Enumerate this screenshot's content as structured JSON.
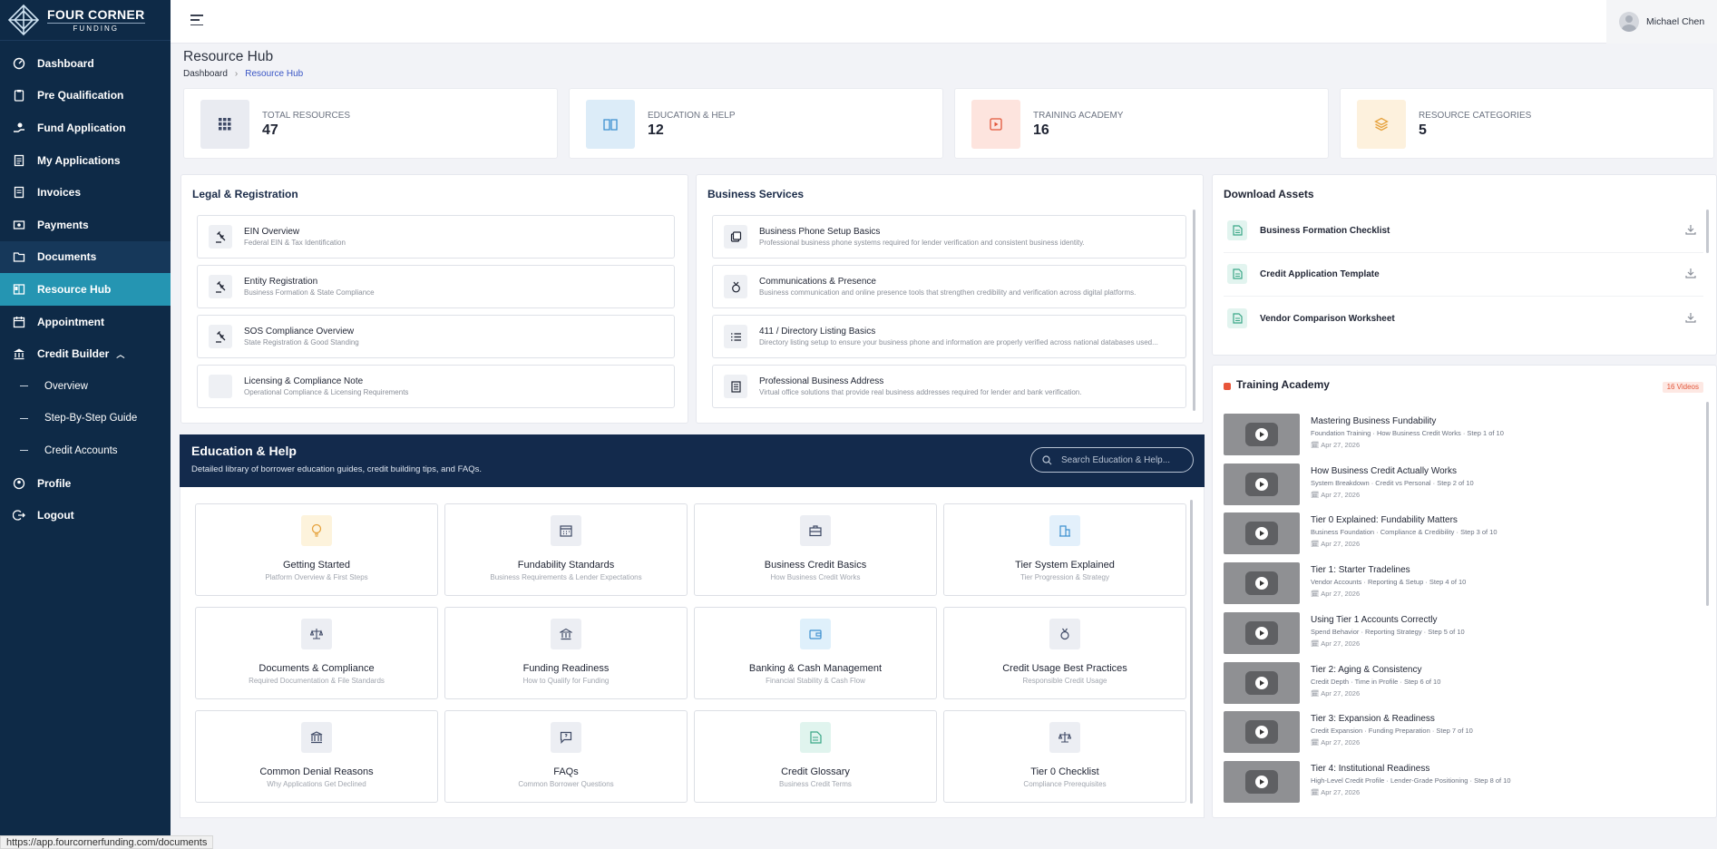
{
  "brand": {
    "title": "FOUR CORNER",
    "subtitle": "FUNDING"
  },
  "sidebar": {
    "items": [
      {
        "label": "Dashboard",
        "icon": "dashboard-icon"
      },
      {
        "label": "Pre Qualification",
        "icon": "clipboard-icon"
      },
      {
        "label": "Fund Application",
        "icon": "hand-coin-icon"
      },
      {
        "label": "My Applications",
        "icon": "file-list-icon"
      },
      {
        "label": "Invoices",
        "icon": "invoice-icon"
      },
      {
        "label": "Payments",
        "icon": "money-icon"
      },
      {
        "label": "Documents",
        "icon": "folder-icon"
      },
      {
        "label": "Resource Hub",
        "icon": "book-icon"
      },
      {
        "label": "Appointment",
        "icon": "calendar-icon"
      },
      {
        "label": "Credit Builder",
        "icon": "bank-icon"
      },
      {
        "label": "Overview"
      },
      {
        "label": "Step-By-Step Guide"
      },
      {
        "label": "Credit Accounts"
      },
      {
        "label": "Profile",
        "icon": "user-icon"
      },
      {
        "label": "Logout",
        "icon": "logout-icon"
      }
    ]
  },
  "topbar": {
    "user_name": "Michael Chen"
  },
  "page": {
    "title": "Resource Hub",
    "breadcrumb": [
      "Dashboard",
      "Resource Hub"
    ]
  },
  "stats": [
    {
      "label": "TOTAL RESOURCES",
      "value": "47",
      "color": "#e9ebf1",
      "icon": "grid-icon"
    },
    {
      "label": "EDUCATION & HELP",
      "value": "12",
      "color": "#dcecf8",
      "icon": "book-open-icon"
    },
    {
      "label": "TRAINING ACADEMY",
      "value": "16",
      "color": "#fde4de",
      "icon": "video-icon"
    },
    {
      "label": "RESOURCE CATEGORIES",
      "value": "5",
      "color": "#fdf1dd",
      "icon": "layers-icon"
    }
  ],
  "legal": {
    "title": "Legal & Registration",
    "rows": [
      {
        "title": "EIN Overview",
        "sub": "Federal EIN & Tax Identification"
      },
      {
        "title": "Entity Registration",
        "sub": "Business Formation & State Compliance"
      },
      {
        "title": "SOS Compliance Overview",
        "sub": "State Registration & Good Standing"
      },
      {
        "title": "Licensing & Compliance Note",
        "sub": "Operational Compliance & Licensing Requirements"
      }
    ]
  },
  "business": {
    "title": "Business Services",
    "rows": [
      {
        "title": "Business Phone Setup Basics",
        "sub": "Professional business phone systems required for lender verification and consistent business identity."
      },
      {
        "title": "Communications & Presence",
        "sub": "Business communication and online presence tools that strengthen credibility and verification across digital platforms."
      },
      {
        "title": "411 / Directory Listing Basics",
        "sub": "Directory listing setup to ensure your business phone and information are properly verified across national databases used..."
      },
      {
        "title": "Professional Business Address",
        "sub": "Virtual office solutions that provide real business addresses required for lender and bank verification."
      }
    ]
  },
  "downloads": {
    "title": "Download Assets",
    "items": [
      "Business Formation Checklist",
      "Credit Application Template",
      "Vendor Comparison Worksheet"
    ]
  },
  "education": {
    "title": "Education & Help",
    "subtitle": "Detailed library of borrower education guides, credit building tips, and FAQs.",
    "search_placeholder": "Search Education & Help...",
    "cards": [
      {
        "title": "Getting Started",
        "sub": "Platform Overview & First Steps",
        "color": "#fdf3dc",
        "icon": "lightbulb-icon"
      },
      {
        "title": "Fundability Standards",
        "sub": "Business Requirements & Lender Expectations",
        "color": "#eceef3",
        "icon": "calendar-grid-icon"
      },
      {
        "title": "Business Credit Basics",
        "sub": "How Business Credit Works",
        "color": "#eceef3",
        "icon": "briefcase-icon"
      },
      {
        "title": "Tier System Explained",
        "sub": "Tier Progression & Strategy",
        "color": "#e3f0fb",
        "icon": "building-icon"
      },
      {
        "title": "Documents & Compliance",
        "sub": "Required Documentation & File Standards",
        "color": "#eceef3",
        "icon": "scale-icon"
      },
      {
        "title": "Funding Readiness",
        "sub": "How to Qualify for Funding",
        "color": "#eceef3",
        "icon": "bank-icon"
      },
      {
        "title": "Banking & Cash Management",
        "sub": "Financial Stability & Cash Flow",
        "color": "#dff0fb",
        "icon": "wallet-icon"
      },
      {
        "title": "Credit Usage Best Practices",
        "sub": "Responsible Credit Usage",
        "color": "#eceef3",
        "icon": "medal-icon"
      },
      {
        "title": "Common Denial Reasons",
        "sub": "Why Applications Get Declined",
        "color": "#eceef3",
        "icon": "institution-icon"
      },
      {
        "title": "FAQs",
        "sub": "Common Borrower Questions",
        "color": "#eceef3",
        "icon": "chat-icon"
      },
      {
        "title": "Credit Glossary",
        "sub": "Business Credit Terms",
        "color": "#e0f4ee",
        "icon": "document-icon"
      },
      {
        "title": "Tier 0 Checklist",
        "sub": "Compliance Prerequisites",
        "color": "#eceef3",
        "icon": "scale-icon"
      }
    ]
  },
  "training": {
    "title": "Training Academy",
    "badge": "16 Videos",
    "videos": [
      {
        "title": "Mastering Business Fundability",
        "sub": "Foundation Training · How Business Credit Works · Step 1 of 10",
        "date": "Apr 27, 2026"
      },
      {
        "title": "How Business Credit Actually Works",
        "sub": "System Breakdown · Credit vs Personal · Step 2 of 10",
        "date": "Apr 27, 2026"
      },
      {
        "title": "Tier 0 Explained: Fundability Matters",
        "sub": "Business Foundation · Compliance & Credibility · Step 3 of 10",
        "date": "Apr 27, 2026"
      },
      {
        "title": "Tier 1: Starter Tradelines",
        "sub": "Vendor Accounts · Reporting & Setup · Step 4 of 10",
        "date": "Apr 27, 2026"
      },
      {
        "title": "Using Tier 1 Accounts Correctly",
        "sub": "Spend Behavior · Reporting Strategy · Step 5 of 10",
        "date": "Apr 27, 2026"
      },
      {
        "title": "Tier 2: Aging & Consistency",
        "sub": "Credit Depth · Time in Profile · Step 6 of 10",
        "date": "Apr 27, 2026"
      },
      {
        "title": "Tier 3: Expansion & Readiness",
        "sub": "Credit Expansion · Funding Preparation · Step 7 of 10",
        "date": "Apr 27, 2026"
      },
      {
        "title": "Tier 4: Institutional Readiness",
        "sub": "High-Level Credit Profile · Lender-Grade Positioning · Step 8 of 10",
        "date": "Apr 27, 2026"
      }
    ]
  },
  "status_url": "https://app.fourcornerfunding.com/documents"
}
